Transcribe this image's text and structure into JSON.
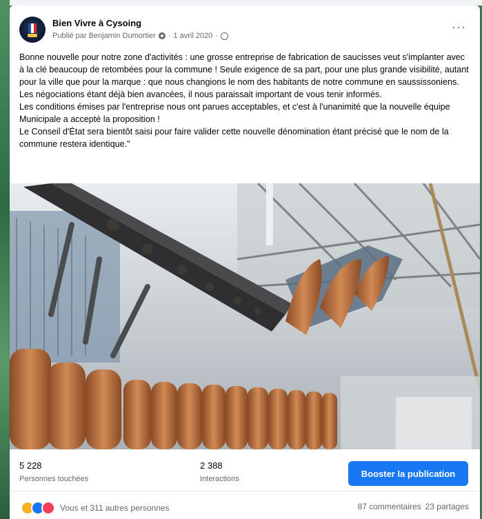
{
  "post": {
    "page_name": "Bien Vivre à Cysoing",
    "published_by": "Publié par Benjamin Dumortier",
    "date": "1 avril 2020",
    "paragraphs": [
      "Bonne nouvelle pour notre zone d'activités : une grosse entreprise de fabrication de saucisses veut s'implanter avec à la clé beaucoup de retombées pour la commune ! Seule exigence de sa part, pour une plus grande visibilité, autant pour la ville que pour la marque : que nous changions le nom des habitants de notre commune en saussissoniens.",
      "Les négociations étant déjà bien avancées, il nous paraissait important de vous tenir informés.",
      "Les conditions émises par l'entreprise nous ont parues acceptables, et c'est à l'unanimité que la nouvelle équipe Municipale a accepté la proposition !",
      "Le Conseil d'État sera bientôt saisi pour faire valider cette nouvelle dénomination étant précisé que le nom de la commune restera identique.\""
    ]
  },
  "stats": {
    "reach_value": "5 228",
    "reach_label": "Personnes touchées",
    "interactions_value": "2 388",
    "interactions_label": "Interactions",
    "boost_label": "Booster la publication"
  },
  "footer": {
    "reactions_text": "Vous et 311 autres personnes",
    "comments": "87 commentaires",
    "shares": "23 partages"
  },
  "icons": {
    "privacy": "gear-icon",
    "audience": "globe-icon",
    "more": "more-options-icon"
  },
  "colors": {
    "accent": "#1877f2",
    "secondary_text": "#65676b"
  }
}
